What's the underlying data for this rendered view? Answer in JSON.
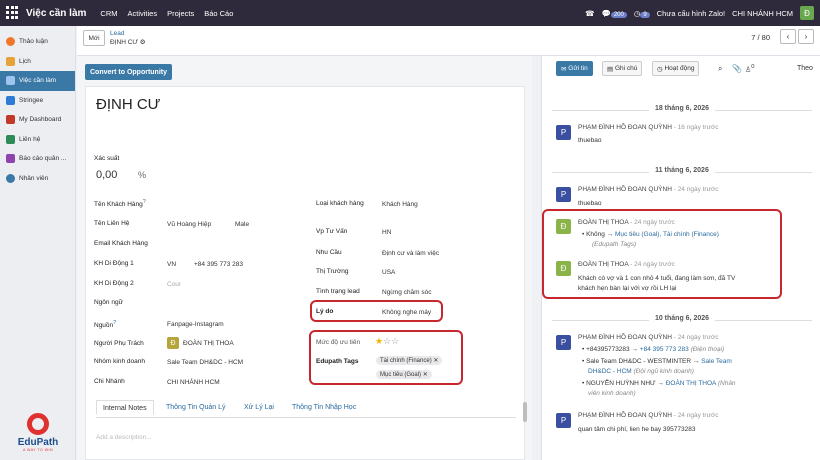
{
  "topbar": {
    "app": "Việc cần làm",
    "menu": [
      "CRM",
      "Activities",
      "Projects",
      "Báo Cáo"
    ],
    "msg_count": "200",
    "activity_count": "9",
    "zalo": "Chưa cấu hình Zalo!",
    "branch": "CHI NHÁNH HCM",
    "user_initial": "Đ"
  },
  "sidebar": {
    "items": [
      {
        "label": "Thảo luận",
        "icon": "discuss-icon",
        "color": "#f0772a"
      },
      {
        "label": "Lịch",
        "icon": "calendar-icon",
        "color": "#e8a23a"
      },
      {
        "label": "Việc cần làm",
        "icon": "pencil-icon",
        "color": "#4a90d9"
      },
      {
        "label": "Stringee",
        "icon": "stringee-icon",
        "color": "#2e7bd6"
      },
      {
        "label": "My Dashboard",
        "icon": "dashboard-icon",
        "color": "#c0392b"
      },
      {
        "label": "Liên hệ",
        "icon": "contacts-icon",
        "color": "#2e8b57"
      },
      {
        "label": "Báo cáo quản ...",
        "icon": "report-icon",
        "color": "#8e44ad"
      },
      {
        "label": "Nhân viên",
        "icon": "employees-icon",
        "color": "#3a78a6"
      }
    ],
    "logo_text": "EduPath",
    "logo_sub": "A WAY TO WIN"
  },
  "control": {
    "new": "Mới",
    "breadcrumb_parent": "Lead",
    "breadcrumb_current": "ĐỊNH CƯ",
    "pager": "7 / 80"
  },
  "form": {
    "convert": "Convert to Opportunity",
    "title": "ĐỊNH CƯ",
    "probability_label": "Xác suất",
    "probability_value": "0,00",
    "probability_unit": "%",
    "fields_left": [
      {
        "label": "Tên Khách Hàng",
        "sup": "?",
        "value": ""
      },
      {
        "label": "Tên Liên Hệ",
        "value": "Vũ Hoàng Hiệp",
        "value2": "Male"
      },
      {
        "label": "Email Khách Hàng",
        "value": ""
      },
      {
        "label": "KH Di Động 1",
        "value": "VN",
        "value2": "+84 395 773 283"
      },
      {
        "label": "KH Di Động 2",
        "value": "Cour",
        "placeholder": true
      },
      {
        "label": "Ngôn ngữ",
        "value": ""
      },
      {
        "label": "Nguồn",
        "sup": "?",
        "value": "Fanpage-Instagram"
      },
      {
        "label": "Người Phụ Trách",
        "value": "ĐOÀN THỊ THOA",
        "avatar": "Đ"
      },
      {
        "label": "Nhóm kinh doanh",
        "value": "Sale Team DH&DC - HCM"
      },
      {
        "label": "Chi Nhánh",
        "value": "CHI NHÁNH HCM"
      }
    ],
    "fields_right": [
      {
        "label": "Loại khách hàng",
        "value": "Khách Hàng"
      },
      {
        "label": "Vp Tư Vấn",
        "value": "HN"
      },
      {
        "label": "Nhu Cầu",
        "value": "Định cư và làm việc"
      },
      {
        "label": "Thị Trường",
        "value": "USA"
      },
      {
        "label": "Tình trạng lead",
        "value": "Ngừng chăm sóc"
      },
      {
        "label": "Lý do",
        "value": "Không nghe máy"
      }
    ],
    "priority_label": "Mức độ ưu tiên",
    "priority_level": 1,
    "priority_max": 3,
    "tags_label": "Edupath Tags",
    "tags": [
      "Tài chính (Finance)",
      "Mục tiêu (Goal)"
    ],
    "tabs": [
      "Internal Notes",
      "Thông Tin Quản Lý",
      "Xử Lý Lại",
      "Thông Tin Nhập Học"
    ],
    "description_placeholder": "Add a description..."
  },
  "chatter": {
    "send": "Gửi tin",
    "note": "Ghi chú",
    "activity": "Hoạt động",
    "follower_count": "0",
    "follow": "Theo",
    "date1": "18 tháng 6, 2026",
    "date2": "11 tháng 6, 2026",
    "date3": "10 tháng 6, 2026",
    "m1": {
      "author": "PHẠM ĐÌNH HỒ ĐOAN QUỲNH",
      "ago": "- 16 ngày trước",
      "text": "thuebao",
      "initial": "P"
    },
    "m2": {
      "author": "PHẠM ĐÌNH HỒ ĐOAN QUỲNH",
      "ago": "- 24 ngày trước",
      "text": "thuebao",
      "initial": "P"
    },
    "m3": {
      "author": "ĐOÀN THỊ THOA",
      "ago": "- 24 ngày trước",
      "from": "Không",
      "to": "Mục tiêu (Goal), Tài chính (Finance)",
      "field": "(Edupath Tags)",
      "initial": "Đ"
    },
    "m4": {
      "author": "ĐOÀN THỊ THOA",
      "ago": "- 24 ngày trước",
      "text1": "Khách có vợ và 1 con nhỏ 4 tuổi, đang làm sơn, đã TV",
      "text2": "khách hẹn bàn lại với vợ rồi LH lại",
      "initial": "Đ"
    },
    "m5": {
      "author": "PHẠM ĐÌNH HỒ ĐOAN QUỲNH",
      "ago": "- 24 ngày trước",
      "initial": "P",
      "c1_from": "+84395773283",
      "c1_to": "+84 395 773 283",
      "c1_field": "(Điện thoại)",
      "c2_from": "Sale Team DH&DC - WESTMINTER",
      "c2_to": "Sale Team",
      "c2_to2": "DH&DC - HCM",
      "c2_field": "(Đội ngũ kinh doanh)",
      "c3_from": "NGUYỄN HUỲNH NHƯ",
      "c3_to": "ĐOÀN THỊ THOA",
      "c3_field": "(Nhân",
      "c3_field2": "viên kinh doanh)"
    },
    "m6": {
      "author": "PHẠM ĐÌNH HỒ ĐOAN QUỲNH",
      "ago": "- 24 ngày trước",
      "text": "quan tâm chi phí, lien he bay 395773283",
      "initial": "P"
    }
  }
}
